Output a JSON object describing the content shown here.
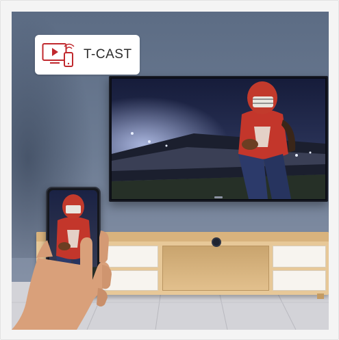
{
  "badge": {
    "label": "T-CAST",
    "icon": "cast-to-tv-icon",
    "accent_color": "#c0282d"
  },
  "scene": {
    "wall_color": "#6d7c93",
    "cabinet_color": "#e7c898",
    "tv_content": "football-player-stadium",
    "phone_content": "football-player-mirrored"
  }
}
